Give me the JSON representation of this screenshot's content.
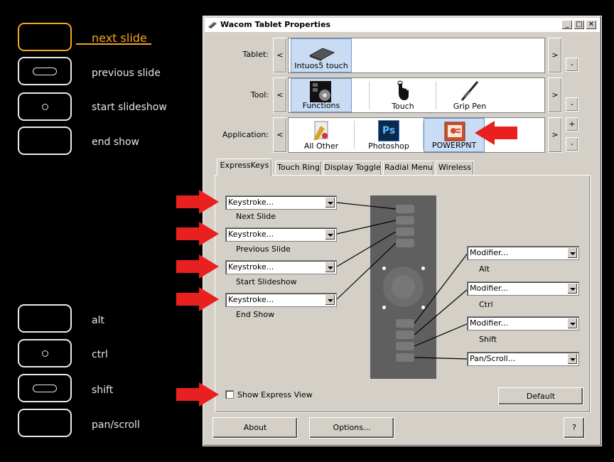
{
  "legend": {
    "top": [
      {
        "label": "next slide",
        "shape": "none",
        "active": true
      },
      {
        "label": "previous slide",
        "shape": "pill",
        "active": false
      },
      {
        "label": "start slideshow",
        "shape": "dot",
        "active": false
      },
      {
        "label": "end show",
        "shape": "none",
        "active": false
      }
    ],
    "bottom": [
      {
        "label": "alt",
        "shape": "none"
      },
      {
        "label": "ctrl",
        "shape": "dot"
      },
      {
        "label": "shift",
        "shape": "pill"
      },
      {
        "label": "pan/scroll",
        "shape": "none"
      }
    ]
  },
  "window": {
    "title": "Wacom Tablet Properties",
    "minimize": "_",
    "maximize": "□",
    "close": "✕"
  },
  "rows": {
    "tablet": {
      "label": "Tablet:",
      "items": [
        {
          "label": "Intuos5 touch",
          "icon": "tablet-icon",
          "selected": true
        }
      ]
    },
    "tool": {
      "label": "Tool:",
      "items": [
        {
          "label": "Functions",
          "icon": "functions-icon",
          "selected": true
        },
        {
          "label": "Touch",
          "icon": "touch-icon",
          "selected": false
        },
        {
          "label": "Grip Pen",
          "icon": "pen-icon",
          "selected": false
        }
      ]
    },
    "application": {
      "label": "Application:",
      "items": [
        {
          "label": "All Other",
          "icon": "all-other-icon",
          "selected": false
        },
        {
          "label": "Photoshop",
          "icon": "photoshop-icon",
          "icon_text": "Ps",
          "selected": false
        },
        {
          "label": "POWERPNT",
          "icon": "powerpoint-icon",
          "selected": true
        }
      ]
    }
  },
  "strip_controls": {
    "prev": "<",
    "next": ">",
    "minus": "-",
    "plus": "+"
  },
  "tabs": [
    "ExpressKeys",
    "Touch Ring",
    "Display Toggle",
    "Radial Menu",
    "Wireless"
  ],
  "active_tab": "ExpressKeys",
  "left_keys": [
    {
      "value": "Keystroke...",
      "caption": "Next Slide"
    },
    {
      "value": "Keystroke...",
      "caption": "Previous Slide"
    },
    {
      "value": "Keystroke...",
      "caption": "Start Slideshow"
    },
    {
      "value": "Keystroke...",
      "caption": "End Show"
    }
  ],
  "right_keys": [
    {
      "value": "Modifier...",
      "caption": "Alt"
    },
    {
      "value": "Modifier...",
      "caption": "Ctrl"
    },
    {
      "value": "Modifier...",
      "caption": "Shift"
    },
    {
      "value": "Pan/Scroll...",
      "caption": ""
    }
  ],
  "show_express_view": {
    "label": "Show Express View",
    "checked": false
  },
  "buttons": {
    "default": "Default",
    "about": "About",
    "options": "Options...",
    "help": "?"
  },
  "colors": {
    "accent": "#f5a623",
    "selection": "#c9dcf3",
    "window": "#d4d0c8",
    "arrow": "#e8201f"
  }
}
